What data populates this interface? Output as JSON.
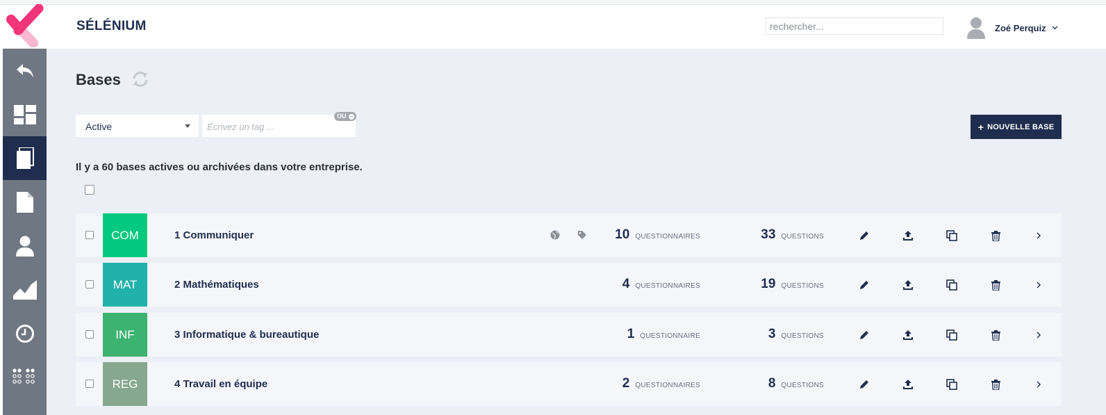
{
  "header": {
    "app_name": "SÉLÉNIUM",
    "search_placeholder": "rechercher...",
    "user_name": "Zoé Perquiz"
  },
  "sidebar": {
    "items": [
      {
        "name": "back",
        "icon": "back-arrow-icon",
        "active": false
      },
      {
        "name": "dashboard",
        "icon": "dashboard-icon",
        "active": false
      },
      {
        "name": "bases",
        "icon": "copy-pages-icon",
        "active": true
      },
      {
        "name": "documents",
        "icon": "document-icon",
        "active": false
      },
      {
        "name": "users",
        "icon": "user-icon",
        "active": false
      },
      {
        "name": "stats",
        "icon": "area-chart-icon",
        "active": false
      },
      {
        "name": "history",
        "icon": "clock-icon",
        "active": false
      },
      {
        "name": "apps",
        "icon": "dots-grid-icon",
        "active": false
      }
    ]
  },
  "page": {
    "title": "Bases",
    "status_filter": "Active",
    "tag_placeholder": "Écrivez un tag ...",
    "tag_mode": "OU",
    "new_button": "NOUVELLE BASE",
    "summary": "Il y a 60 bases actives ou archivées dans votre entreprise."
  },
  "rows": [
    {
      "code": "COM",
      "color": "#02c97e",
      "name": "1 Communiquer",
      "icons": true,
      "questionnaires": "10",
      "questionnaires_label": "QUESTIONNAIRES",
      "questions": "33",
      "questions_label": "QUESTIONS"
    },
    {
      "code": "MAT",
      "color": "#20b2aa",
      "name": "2 Mathématiques",
      "icons": false,
      "questionnaires": "4",
      "questionnaires_label": "QUESTIONNAIRES",
      "questions": "19",
      "questions_label": "QUESTIONS"
    },
    {
      "code": "INF",
      "color": "#3cb371",
      "name": "3 Informatique & bureautique",
      "icons": false,
      "questionnaires": "1",
      "questionnaires_label": "QUESTIONNAIRE",
      "questions": "3",
      "questions_label": "QUESTIONS"
    },
    {
      "code": "REG",
      "color": "#86a88f",
      "name": "4 Travail en équipe",
      "icons": false,
      "questionnaires": "2",
      "questionnaires_label": "QUESTIONNAIRES",
      "questions": "8",
      "questions_label": "QUESTIONS"
    }
  ],
  "colors": {
    "navy": "#1f2d4e",
    "sidebar": "#6f7782",
    "background": "#eceff5",
    "logo_pink": "#f0357a",
    "logo_light_pink": "#f6b7cf"
  }
}
